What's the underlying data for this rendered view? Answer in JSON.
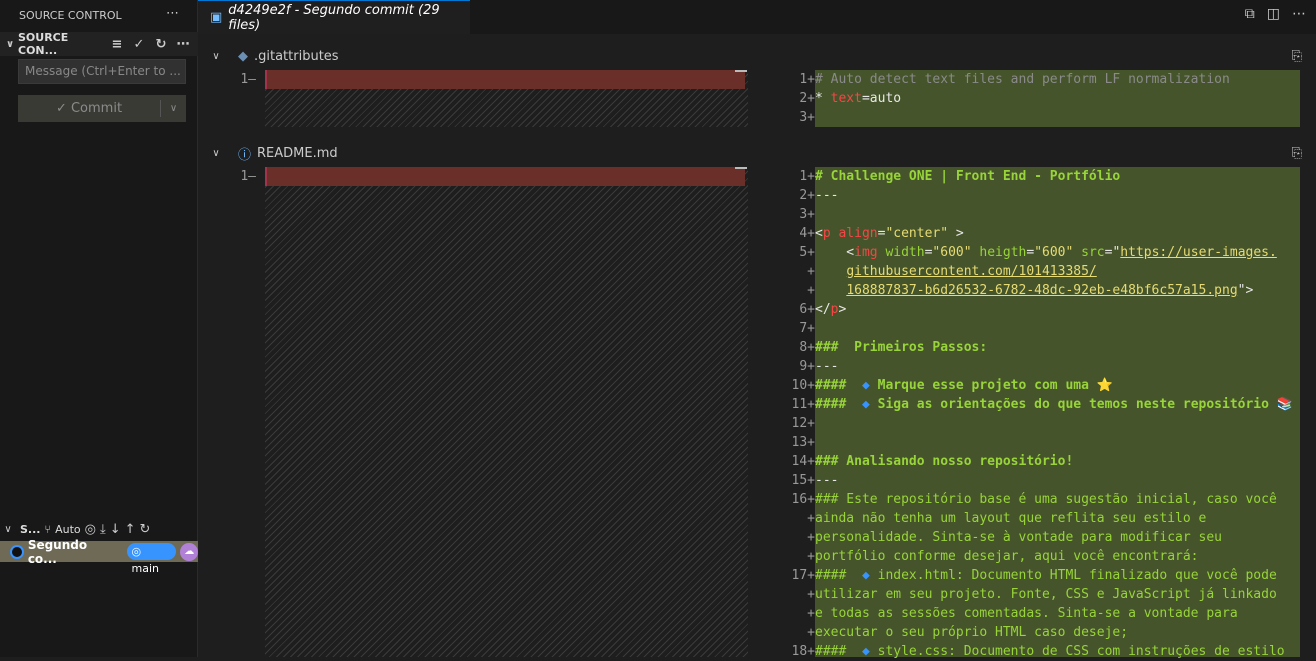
{
  "sidebar": {
    "title": "SOURCE CONTROL",
    "section": "SOURCE CON...",
    "message_placeholder": "Message (Ctrl+Enter to ...",
    "commit_label": "Commit",
    "graph": {
      "title": "S...",
      "auto_label": "Auto",
      "commit": "Segundo co...",
      "branch": "main"
    }
  },
  "tab": {
    "title": "d4249e2f - Segundo commit (29 files)"
  },
  "files": [
    {
      "name": ".gitattributes",
      "icon": "git-icon",
      "lines": [
        {
          "n": "1",
          "segs": [
            [
              "# Auto detect text files and perform LF normalization",
              "c"
            ]
          ]
        },
        {
          "n": "2",
          "segs": [
            [
              "* ",
              "w"
            ],
            [
              "text",
              "r"
            ],
            [
              "=auto",
              "w"
            ]
          ]
        },
        {
          "n": "3",
          "segs": []
        }
      ]
    },
    {
      "name": "README.md",
      "icon": "info-icon",
      "lines": [
        {
          "n": "1",
          "segs": [
            [
              "# Challenge ONE | Front End - Portfólio",
              "h"
            ]
          ]
        },
        {
          "n": "2",
          "segs": [
            [
              "---",
              "w"
            ]
          ]
        },
        {
          "n": "3",
          "segs": []
        },
        {
          "n": "4",
          "segs": [
            [
              "<",
              "w"
            ],
            [
              "p",
              "r"
            ],
            [
              " align",
              "r"
            ],
            [
              "=",
              "w"
            ],
            [
              "\"center\"",
              "s"
            ],
            [
              " >",
              "w"
            ]
          ]
        },
        {
          "n": "5",
          "segs": [
            [
              "    <",
              "w"
            ],
            [
              "img",
              "r"
            ],
            [
              " width",
              "t"
            ],
            [
              "=",
              "w"
            ],
            [
              "\"600\"",
              "s"
            ],
            [
              " heigth",
              "t"
            ],
            [
              "=",
              "w"
            ],
            [
              "\"600\"",
              "s"
            ],
            [
              " src",
              "t"
            ],
            [
              "=\"",
              "w"
            ],
            [
              "https://user-images.",
              "u"
            ]
          ]
        },
        {
          "n": "",
          "segs": [
            [
              "    ",
              "w"
            ],
            [
              "githubusercontent.com/101413385/",
              "u"
            ]
          ]
        },
        {
          "n": "",
          "segs": [
            [
              "    ",
              "w"
            ],
            [
              "168887837-b6d26532-6782-48dc-92eb-e48bf6c57a15.png",
              "u"
            ],
            [
              "\">",
              "w"
            ]
          ]
        },
        {
          "n": "6",
          "segs": [
            [
              "</",
              "w"
            ],
            [
              "p",
              "r"
            ],
            [
              ">",
              "w"
            ]
          ]
        },
        {
          "n": "7",
          "segs": []
        },
        {
          "n": "8",
          "segs": [
            [
              "###  Primeiros Passos:",
              "h"
            ]
          ]
        },
        {
          "n": "9",
          "segs": [
            [
              "---",
              "w"
            ]
          ]
        },
        {
          "n": "10",
          "segs": [
            [
              "####  ",
              "h"
            ],
            [
              "◆",
              "b"
            ],
            [
              " Marque esse projeto com uma ⭐",
              "h"
            ]
          ]
        },
        {
          "n": "11",
          "segs": [
            [
              "####  ",
              "h"
            ],
            [
              "◆",
              "b"
            ],
            [
              " Siga as orientações do que temos neste repositório 📚",
              "h"
            ]
          ]
        },
        {
          "n": "12",
          "segs": []
        },
        {
          "n": "13",
          "segs": []
        },
        {
          "n": "14",
          "segs": [
            [
              "### Analisando nosso repositório!",
              "h"
            ]
          ]
        },
        {
          "n": "15",
          "segs": [
            [
              "---",
              "w"
            ]
          ]
        },
        {
          "n": "16",
          "segs": [
            [
              "### Este repositório base é uma sugestão inicial, caso você",
              "t"
            ]
          ]
        },
        {
          "n": "",
          "segs": [
            [
              "ainda não tenha um layout que reflita seu estilo e",
              "t"
            ]
          ]
        },
        {
          "n": "",
          "segs": [
            [
              "personalidade. Sinta-se à vontade para modificar seu",
              "t"
            ]
          ]
        },
        {
          "n": "",
          "segs": [
            [
              "portfólio conforme desejar, aqui você encontrará:",
              "t"
            ]
          ]
        },
        {
          "n": "17",
          "segs": [
            [
              "####  ",
              "t"
            ],
            [
              "◆",
              "b"
            ],
            [
              " index.html: Documento HTML finalizado que você pode",
              "t"
            ]
          ]
        },
        {
          "n": "",
          "segs": [
            [
              "utilizar em seu projeto. Fonte, CSS e JavaScript já linkado",
              "t"
            ]
          ]
        },
        {
          "n": "",
          "segs": [
            [
              "e todas as sessões comentadas. Sinta-se a vontade para",
              "t"
            ]
          ]
        },
        {
          "n": "",
          "segs": [
            [
              "executar o seu próprio HTML caso deseje;",
              "t"
            ]
          ]
        },
        {
          "n": "18",
          "segs": [
            [
              "####  ",
              "t"
            ],
            [
              "◆",
              "b"
            ],
            [
              " style.css: Documento de CSS com instruções de estilo",
              "t"
            ]
          ]
        }
      ]
    }
  ]
}
